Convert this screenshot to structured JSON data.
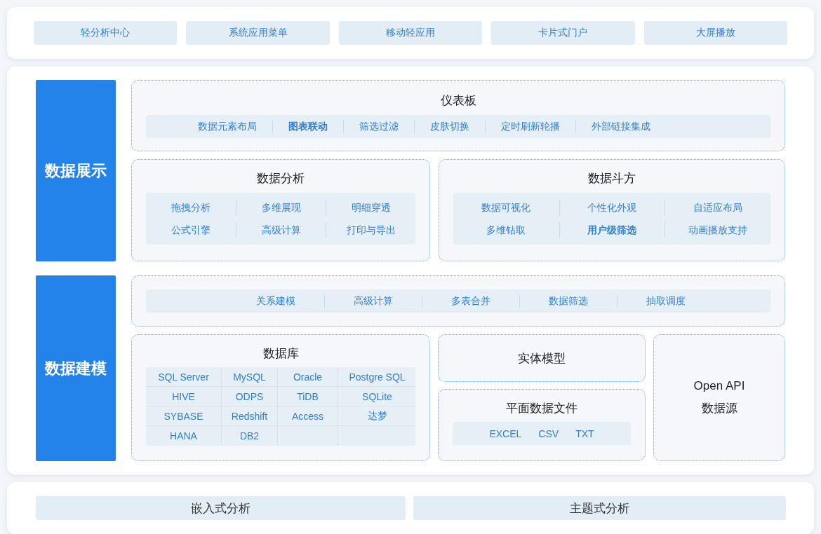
{
  "app_menu": [
    "轻分析中心",
    "系统应用菜单",
    "移动轻应用",
    "卡片式门户",
    "大屏播放"
  ],
  "display": {
    "label": "数据展示",
    "dashboard": {
      "title": "仪表板",
      "features": [
        {
          "label": "数据元素布局",
          "bold": false
        },
        {
          "label": "图表联动",
          "bold": true
        },
        {
          "label": "筛选过滤",
          "bold": false
        },
        {
          "label": "皮肤切换",
          "bold": false
        },
        {
          "label": "定时刷新轮播",
          "bold": false
        },
        {
          "label": "外部链接集成",
          "bold": false
        }
      ]
    },
    "analysis": {
      "title": "数据分析",
      "features": [
        {
          "label": "拖拽分析",
          "bold": false
        },
        {
          "label": "多维展现",
          "bold": false
        },
        {
          "label": "明细穿透",
          "bold": false
        },
        {
          "label": "公式引擎",
          "bold": false
        },
        {
          "label": "高级计算",
          "bold": false
        },
        {
          "label": "打印与导出",
          "bold": false
        }
      ]
    },
    "doufang": {
      "title": "数据斗方",
      "features": [
        {
          "label": "数据可视化",
          "bold": false
        },
        {
          "label": "个性化外观",
          "bold": false
        },
        {
          "label": "自适应布局",
          "bold": false
        },
        {
          "label": "多维钻取",
          "bold": false
        },
        {
          "label": "用户级筛选",
          "bold": true
        },
        {
          "label": "动画播放支持",
          "bold": false
        }
      ]
    }
  },
  "modeling": {
    "label": "数据建模",
    "features": [
      {
        "label": "关系建模",
        "bold": false
      },
      {
        "label": "高级计算",
        "bold": false
      },
      {
        "label": "多表合并",
        "bold": false
      },
      {
        "label": "数据筛选",
        "bold": false
      },
      {
        "label": "抽取调度",
        "bold": false
      }
    ],
    "database": {
      "title": "数据库",
      "rows": [
        [
          "SQL Server",
          "MySQL",
          "Oracle",
          "Postgre SQL"
        ],
        [
          "HIVE",
          "ODPS",
          "TiDB",
          "SQLite"
        ],
        [
          "SYBASE",
          "Redshift",
          "Access",
          "达梦"
        ],
        [
          "HANA",
          "DB2"
        ]
      ]
    },
    "entity_model": {
      "title": "实体模型"
    },
    "flat_files": {
      "title": "平面数据文件",
      "formats": [
        "EXCEL",
        "CSV",
        "TXT"
      ]
    },
    "open_api": {
      "lines": [
        "Open API",
        "数据源"
      ]
    }
  },
  "bottom_menu": [
    "嵌入式分析",
    "主题式分析"
  ]
}
